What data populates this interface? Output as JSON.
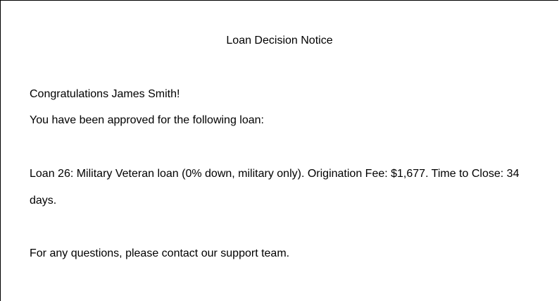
{
  "document": {
    "title": "Loan Decision Notice",
    "greeting": "Congratulations James Smith!",
    "intro": "You have been approved for the following loan:",
    "loan_details": "Loan 26: Military Veteran loan (0% down, military only). Origination Fee: $1,677. Time to Close: 34 days.",
    "closing": "For any questions, please contact our support team."
  }
}
